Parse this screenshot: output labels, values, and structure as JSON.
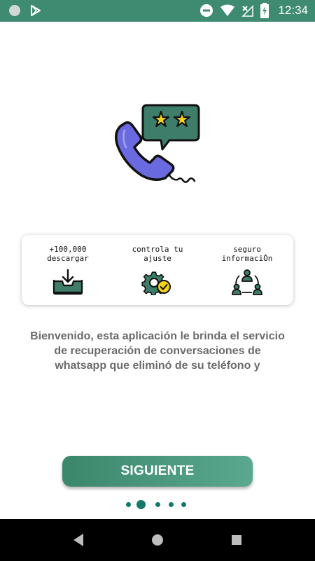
{
  "status_bar": {
    "time": "12:34",
    "left_icons": [
      "circle-notification-icon",
      "play-store-icon"
    ],
    "right_icons": [
      "do-not-disturb-icon",
      "wifi-icon",
      "signal-off-icon",
      "battery-charging-icon"
    ],
    "color": "#3e8b72"
  },
  "hero": {
    "icon": "phone-review-stars-icon"
  },
  "features": [
    {
      "label": "+100,000\ndescargar",
      "icon": "inbox-download-icon"
    },
    {
      "label": "controla tu\najuste",
      "icon": "gear-check-icon"
    },
    {
      "label": "seguro\ninformaciÓn",
      "icon": "users-network-icon"
    }
  ],
  "description": "Bienvenido, esta aplicación le brinda el servicio de recuperación de conversaciones de whatsapp que eliminó de su teléfono y",
  "button": {
    "label": "SIGUIENTE",
    "color": "#3b876c"
  },
  "pager": {
    "count": 5,
    "current": 2
  },
  "nav_bar": {
    "buttons": [
      "back-icon",
      "home-icon",
      "recents-icon"
    ]
  }
}
